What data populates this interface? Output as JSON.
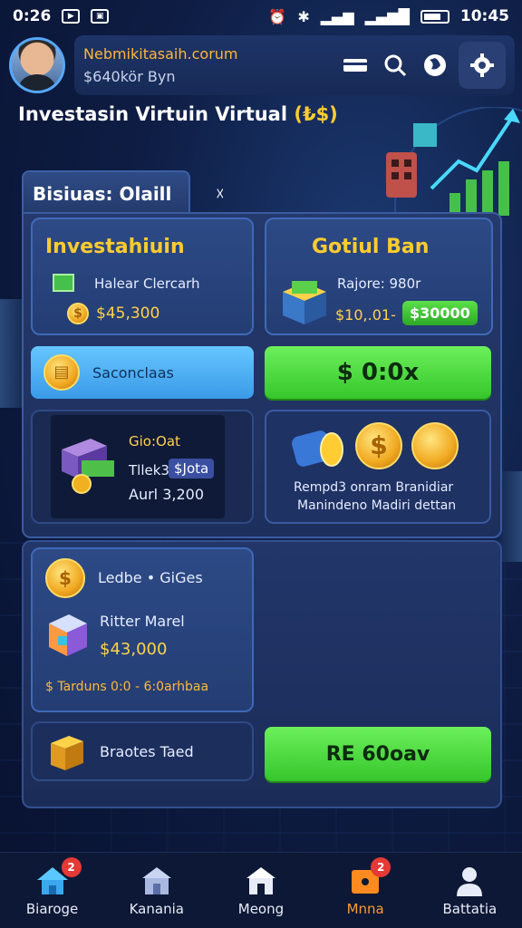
{
  "status_bar": {
    "time_left": "0:26",
    "time_right": "10:45"
  },
  "header": {
    "user_name": "Nebmikitasaih.corum",
    "balance": "$640kör Byn"
  },
  "page_title": {
    "text": "Investasin Virtuin Virtual",
    "currency": "(₺$)"
  },
  "panel": {
    "tab_label": "Bisiuas: Olaill",
    "tab_extra": "☓"
  },
  "cards": {
    "invest": {
      "title": "Investahiuin",
      "label": "Halear Clercarh",
      "value": "$45,300"
    },
    "gold": {
      "title": "Gotiul Ban",
      "label": "Rajore: 980r",
      "value": "$10,.01-",
      "tag": "$30000"
    },
    "secondary_button": "Saconclaas",
    "green_button": "$ 0:0x",
    "crate": {
      "line1": "Gio:Oat",
      "line2": "Tllek3",
      "tag": "$Jota",
      "line3": "Aurl 3,200"
    },
    "rewards": {
      "line1": "Rempd3 onram Branidiar",
      "line2": "Manindeno Madiri dettan"
    },
    "ledger": {
      "title": "Ledbe • GiGes",
      "item": "Ritter Marel",
      "value": "$43,000",
      "footer": "$ Tarduns 0:0 - 6:0arhbaa"
    },
    "bottom_left": "Braotes Taed",
    "bottom_button": "RE 60oav"
  },
  "nav": [
    {
      "label": "Biaroge",
      "badge": "2"
    },
    {
      "label": "Kanania",
      "badge": ""
    },
    {
      "label": "Meong",
      "badge": ""
    },
    {
      "label": "Mnna",
      "badge": "2"
    },
    {
      "label": "Battatia",
      "badge": ""
    }
  ],
  "colors": {
    "accent_gold": "#ffcc2e",
    "accent_green": "#4ee03c",
    "panel_blue": "#25396c",
    "bg": "#0e1d44"
  }
}
